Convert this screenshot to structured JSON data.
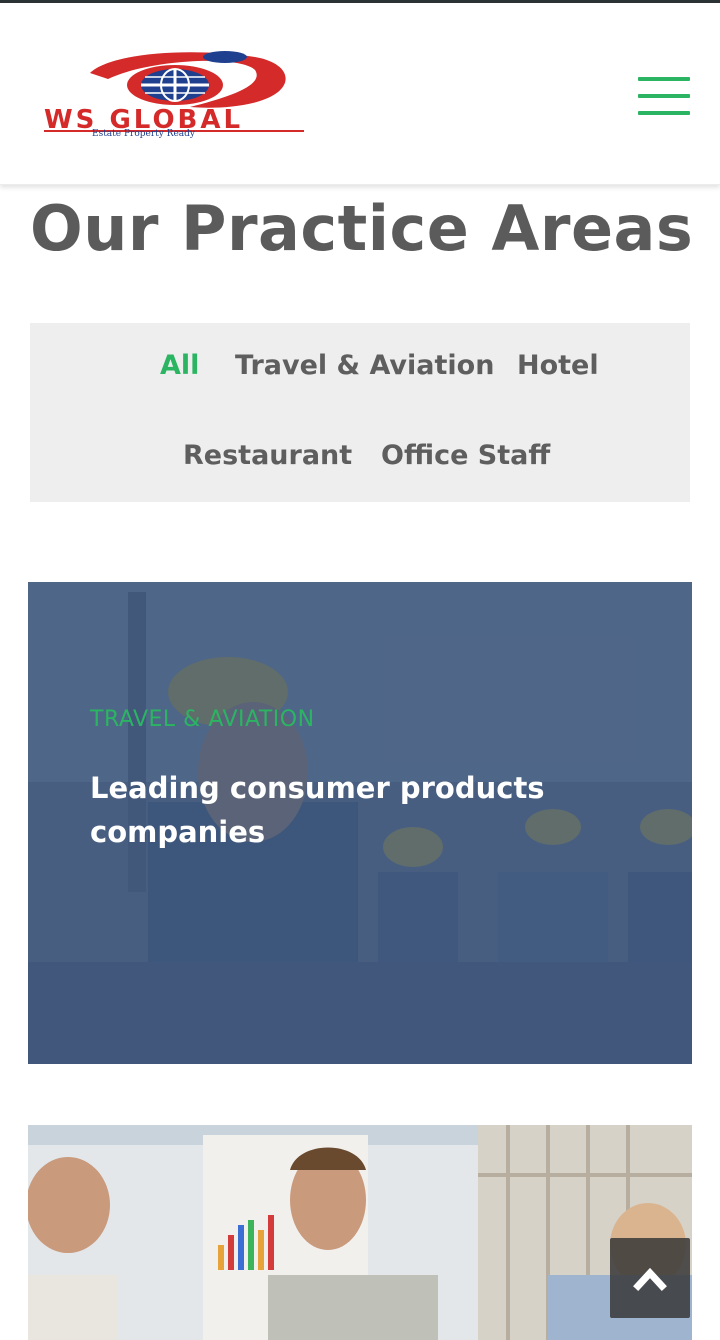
{
  "header": {
    "logo_text": "WS GLOBAL",
    "logo_tagline": "Estate Property Ready",
    "menu_icon": "hamburger-menu-icon",
    "brand_color": "#2bb562"
  },
  "page": {
    "title": "Our Practice Areas"
  },
  "filters": [
    {
      "label": "All",
      "active": true
    },
    {
      "label": "Travel & Aviation",
      "active": false
    },
    {
      "label": "Hotel",
      "active": false
    },
    {
      "label": "Restaurant",
      "active": false
    },
    {
      "label": "Office Staff",
      "active": false
    }
  ],
  "cards": [
    {
      "category": "TRAVEL & AVIATION",
      "title": "Leading consumer products companies",
      "image": "construction workers photo"
    },
    {
      "image": "office team celebrating photo"
    }
  ],
  "scroll_top": {
    "icon": "chevron-up-icon"
  },
  "colors": {
    "accent": "#2bb562",
    "title_text": "#5b5b5b",
    "filter_bg": "#eeeeee",
    "card_overlay": "#385278"
  }
}
